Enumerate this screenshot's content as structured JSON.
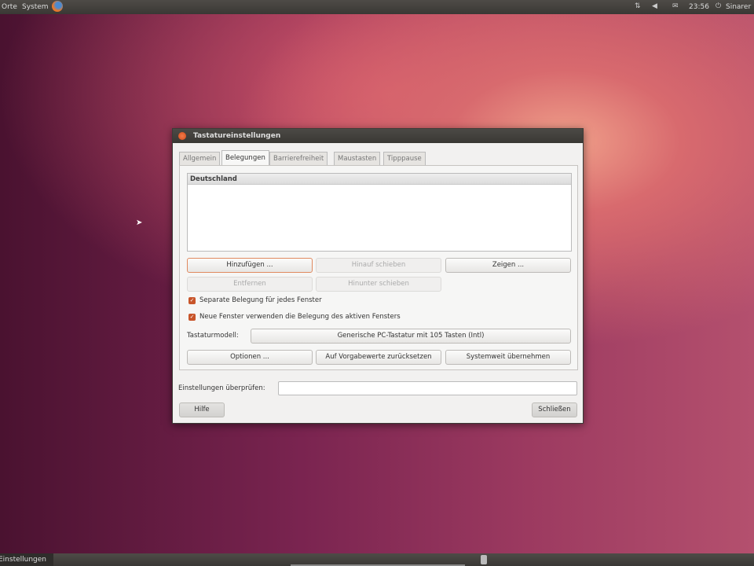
{
  "top_panel": {
    "menus": [
      "Orte",
      "System"
    ],
    "clock": "23:56",
    "user": "Sinarer"
  },
  "dialog": {
    "title": "Tastatureinstellungen",
    "tabs": [
      "Allgemein",
      "Belegungen",
      "Barrierefreiheit",
      "Maustasten",
      "Tipppause"
    ],
    "active_tab": "Belegungen",
    "layouts_header": "Deutschland",
    "buttons": {
      "add": "Hinzufügen ...",
      "move_up": "Hinauf schieben",
      "show": "Zeigen ...",
      "remove": "Entfernen",
      "move_down": "Hinunter schieben",
      "options": "Optionen ...",
      "reset": "Auf Vorgabewerte zurücksetzen",
      "system_wide": "Systemweit übernehmen",
      "help": "Hilfe",
      "close": "Schließen"
    },
    "checkboxes": [
      {
        "label": "Separate Belegung für jedes Fenster",
        "checked": true
      },
      {
        "label": "Neue Fenster verwenden die Belegung des aktiven Fensters",
        "checked": true
      }
    ],
    "keyboard_model_label": "Tastaturmodell:",
    "keyboard_model_value": "Generische PC-Tastatur mit 105 Tasten (Intl)",
    "test_label": "Einstellungen überprüfen:",
    "test_value": ""
  },
  "bottom_panel": {
    "task": "Einstellungen"
  }
}
